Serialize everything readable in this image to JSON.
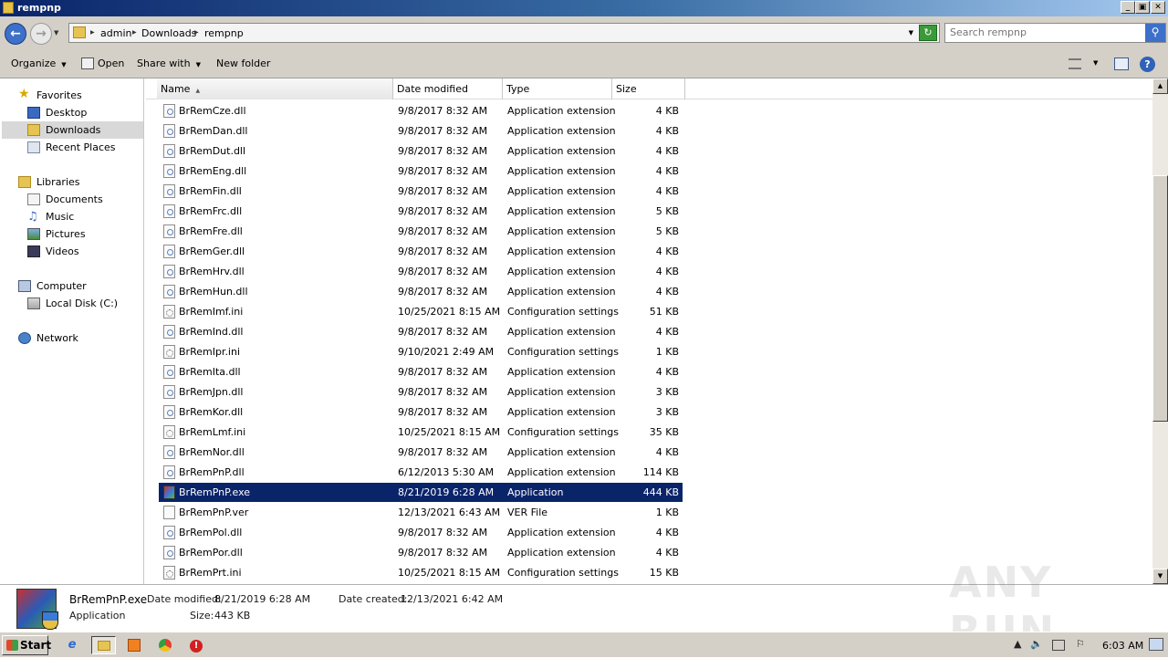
{
  "window": {
    "title": "rempnp",
    "controls": {
      "minimize": "_",
      "maximize": "▣",
      "close": "✕"
    }
  },
  "address": {
    "breadcrumbs": [
      "admin",
      "Downloads",
      "rempnp"
    ],
    "search_placeholder": "Search rempnp"
  },
  "toolbar": {
    "organize": "Organize",
    "open": "Open",
    "share_with": "Share with",
    "new_folder": "New folder"
  },
  "nav": {
    "favorites": "Favorites",
    "desktop": "Desktop",
    "downloads": "Downloads",
    "recent_places": "Recent Places",
    "libraries": "Libraries",
    "documents": "Documents",
    "music": "Music",
    "pictures": "Pictures",
    "videos": "Videos",
    "computer": "Computer",
    "local_disk": "Local Disk (C:)",
    "network": "Network"
  },
  "columns": {
    "name": "Name",
    "date": "Date modified",
    "type": "Type",
    "size": "Size"
  },
  "files": [
    {
      "name": "BrRemCze.dll",
      "date": "9/8/2017 8:32 AM",
      "type": "Application extension",
      "size": "4 KB",
      "icon": "dll"
    },
    {
      "name": "BrRemDan.dll",
      "date": "9/8/2017 8:32 AM",
      "type": "Application extension",
      "size": "4 KB",
      "icon": "dll"
    },
    {
      "name": "BrRemDut.dll",
      "date": "9/8/2017 8:32 AM",
      "type": "Application extension",
      "size": "4 KB",
      "icon": "dll"
    },
    {
      "name": "BrRemEng.dll",
      "date": "9/8/2017 8:32 AM",
      "type": "Application extension",
      "size": "4 KB",
      "icon": "dll"
    },
    {
      "name": "BrRemFin.dll",
      "date": "9/8/2017 8:32 AM",
      "type": "Application extension",
      "size": "4 KB",
      "icon": "dll"
    },
    {
      "name": "BrRemFrc.dll",
      "date": "9/8/2017 8:32 AM",
      "type": "Application extension",
      "size": "5 KB",
      "icon": "dll"
    },
    {
      "name": "BrRemFre.dll",
      "date": "9/8/2017 8:32 AM",
      "type": "Application extension",
      "size": "5 KB",
      "icon": "dll"
    },
    {
      "name": "BrRemGer.dll",
      "date": "9/8/2017 8:32 AM",
      "type": "Application extension",
      "size": "4 KB",
      "icon": "dll"
    },
    {
      "name": "BrRemHrv.dll",
      "date": "9/8/2017 8:32 AM",
      "type": "Application extension",
      "size": "4 KB",
      "icon": "dll"
    },
    {
      "name": "BrRemHun.dll",
      "date": "9/8/2017 8:32 AM",
      "type": "Application extension",
      "size": "4 KB",
      "icon": "dll"
    },
    {
      "name": "BrRemImf.ini",
      "date": "10/25/2021 8:15 AM",
      "type": "Configuration settings",
      "size": "51 KB",
      "icon": "ini"
    },
    {
      "name": "BrRemInd.dll",
      "date": "9/8/2017 8:32 AM",
      "type": "Application extension",
      "size": "4 KB",
      "icon": "dll"
    },
    {
      "name": "BrRemIpr.ini",
      "date": "9/10/2021 2:49 AM",
      "type": "Configuration settings",
      "size": "1 KB",
      "icon": "ini"
    },
    {
      "name": "BrRemIta.dll",
      "date": "9/8/2017 8:32 AM",
      "type": "Application extension",
      "size": "4 KB",
      "icon": "dll"
    },
    {
      "name": "BrRemJpn.dll",
      "date": "9/8/2017 8:32 AM",
      "type": "Application extension",
      "size": "3 KB",
      "icon": "dll"
    },
    {
      "name": "BrRemKor.dll",
      "date": "9/8/2017 8:32 AM",
      "type": "Application extension",
      "size": "3 KB",
      "icon": "dll"
    },
    {
      "name": "BrRemLmf.ini",
      "date": "10/25/2021 8:15 AM",
      "type": "Configuration settings",
      "size": "35 KB",
      "icon": "ini"
    },
    {
      "name": "BrRemNor.dll",
      "date": "9/8/2017 8:32 AM",
      "type": "Application extension",
      "size": "4 KB",
      "icon": "dll"
    },
    {
      "name": "BrRemPnP.dll",
      "date": "6/12/2013 5:30 AM",
      "type": "Application extension",
      "size": "114 KB",
      "icon": "dll"
    },
    {
      "name": "BrRemPnP.exe",
      "date": "8/21/2019 6:28 AM",
      "type": "Application",
      "size": "444 KB",
      "icon": "exe",
      "selected": true
    },
    {
      "name": "BrRemPnP.ver",
      "date": "12/13/2021 6:43 AM",
      "type": "VER File",
      "size": "1 KB",
      "icon": "blank"
    },
    {
      "name": "BrRemPol.dll",
      "date": "9/8/2017 8:32 AM",
      "type": "Application extension",
      "size": "4 KB",
      "icon": "dll"
    },
    {
      "name": "BrRemPor.dll",
      "date": "9/8/2017 8:32 AM",
      "type": "Application extension",
      "size": "4 KB",
      "icon": "dll"
    },
    {
      "name": "BrRemPrt.ini",
      "date": "10/25/2021 8:15 AM",
      "type": "Configuration settings",
      "size": "15 KB",
      "icon": "ini"
    }
  ],
  "details": {
    "filename": "BrRemPnP.exe",
    "date_modified_label": "Date modified:",
    "date_modified": "8/21/2019 6:28 AM",
    "date_created_label": "Date created:",
    "date_created": "12/13/2021 6:42 AM",
    "type": "Application",
    "size_label": "Size:",
    "size": "443 KB"
  },
  "watermark": "ANY RUN",
  "taskbar": {
    "start": "Start",
    "clock": "6:03 AM"
  },
  "colors": {
    "selection": "#0a246a",
    "chrome": "#d4d0c8"
  }
}
